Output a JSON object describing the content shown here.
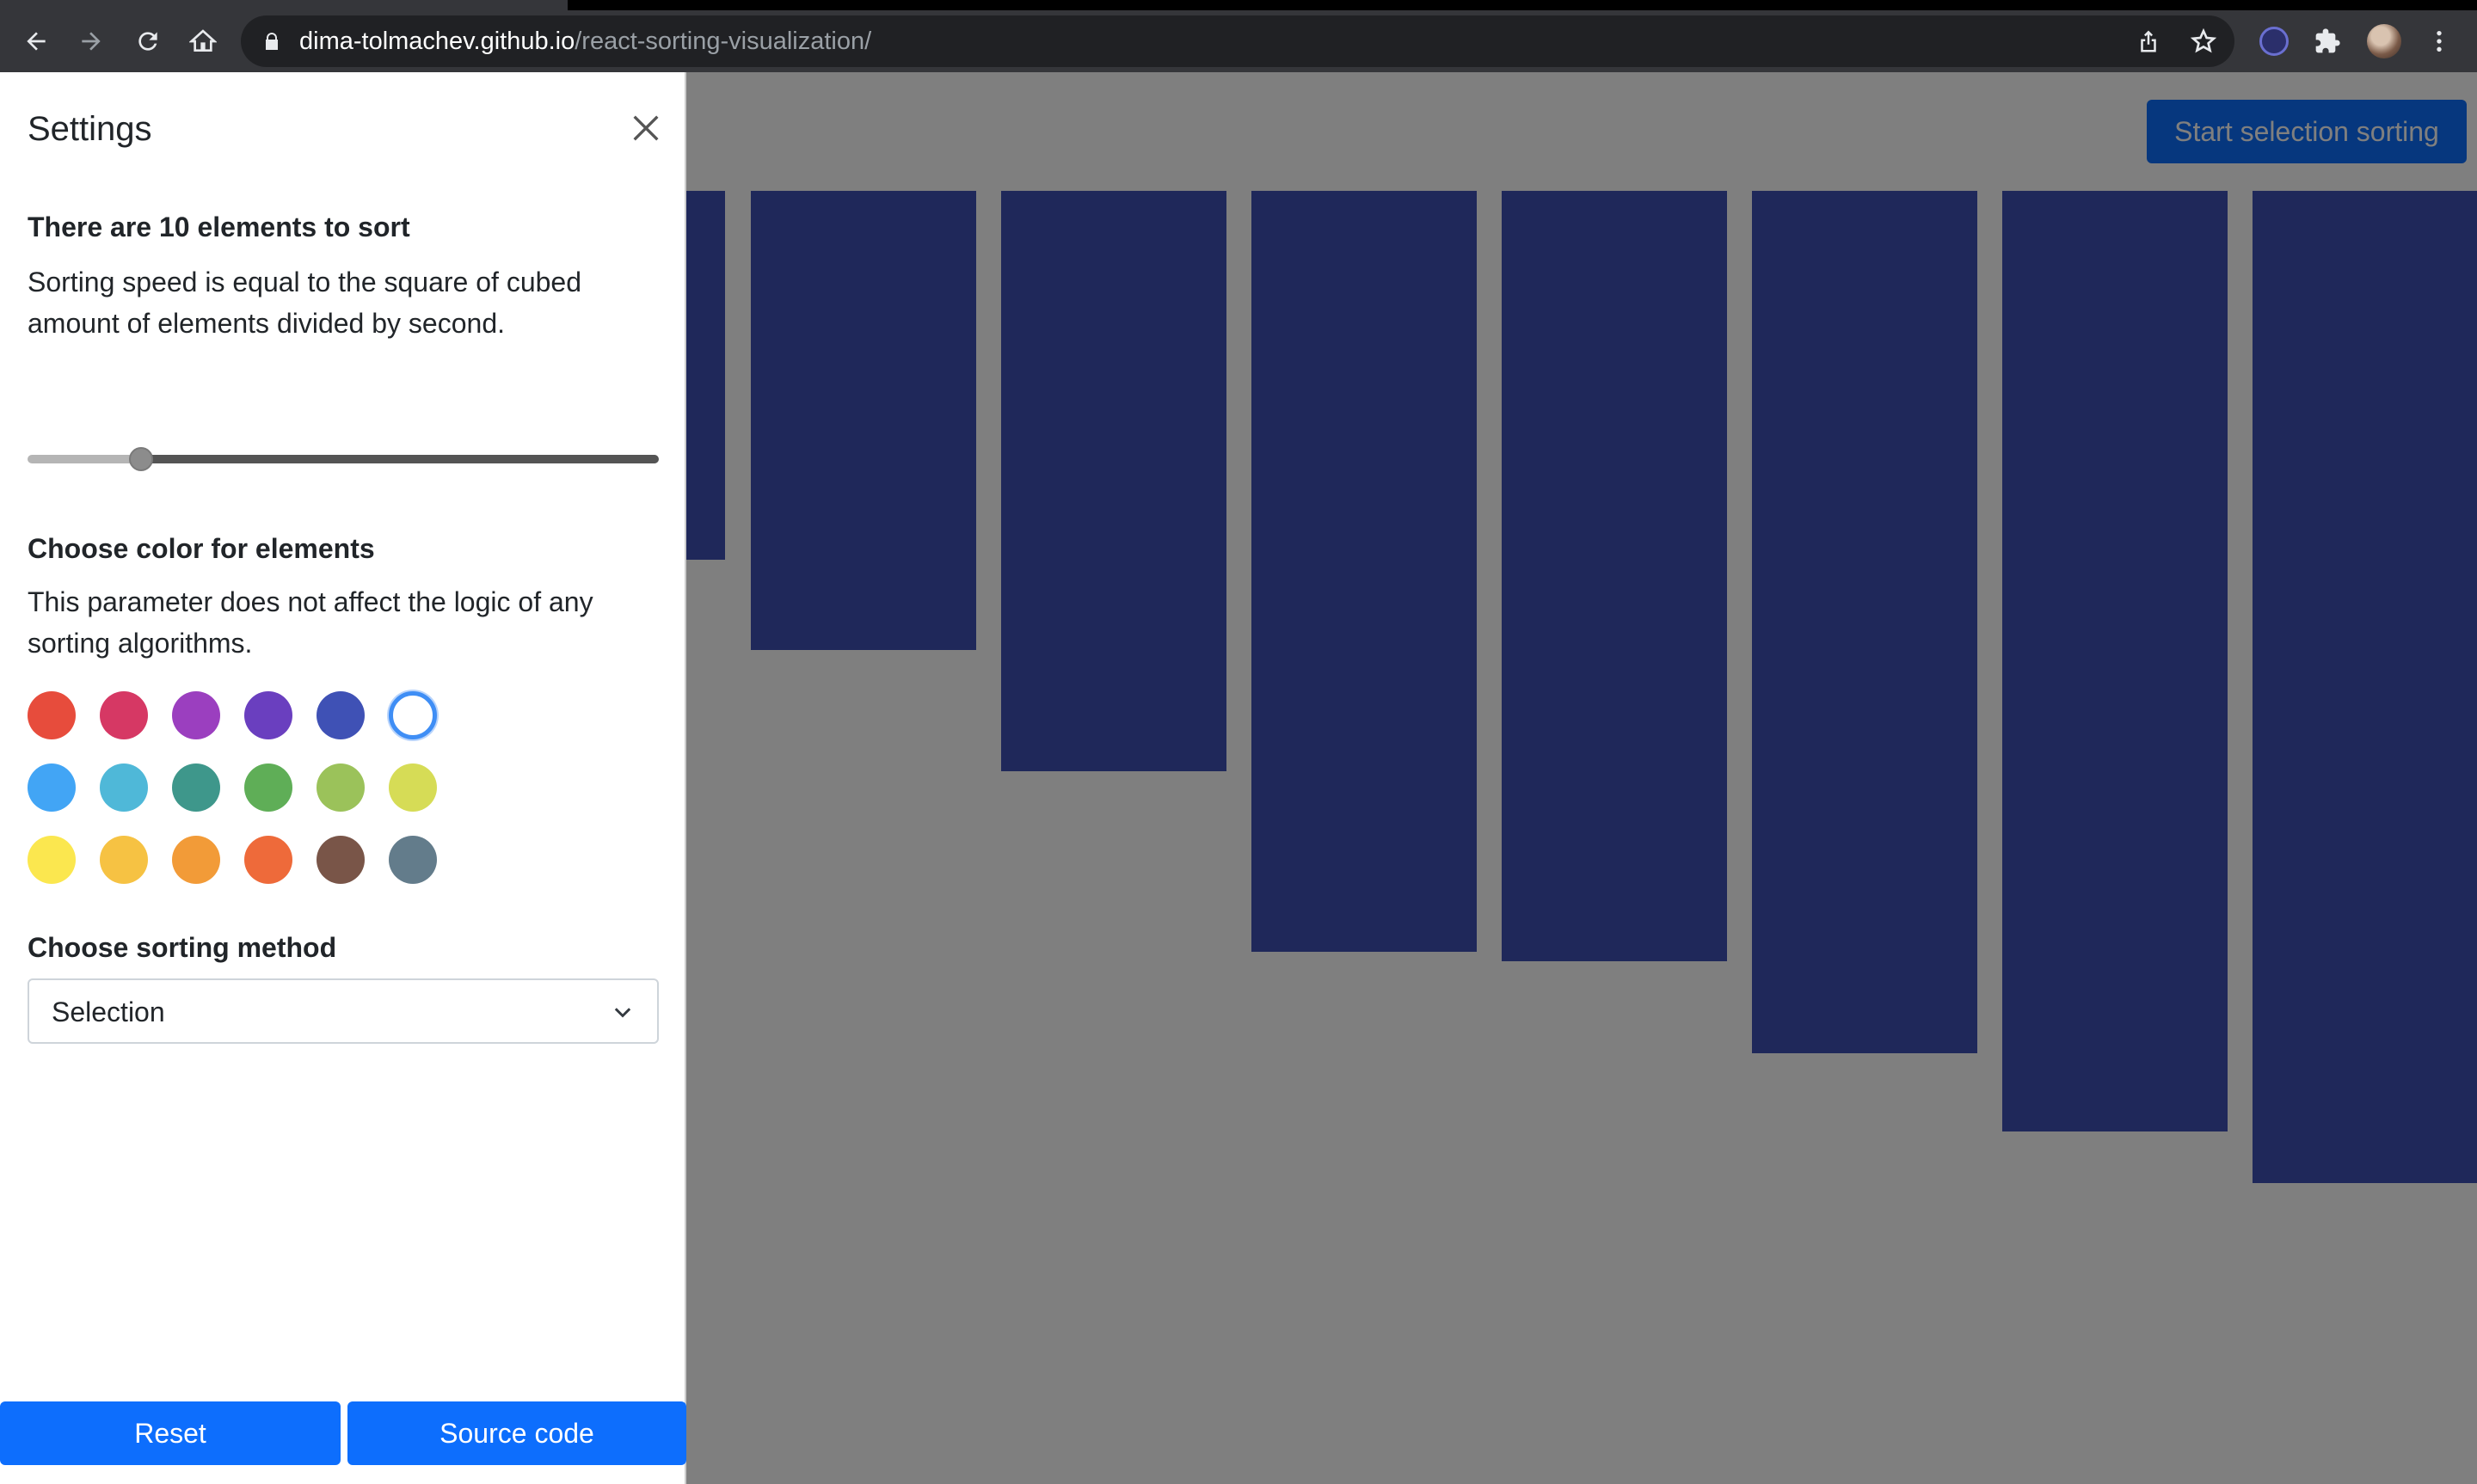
{
  "browser": {
    "url_host": "dima-tolmachev.github.io",
    "url_path": "/react-sorting-visualization/"
  },
  "main": {
    "start_button_label": "Start selection sorting",
    "bar_color": "#3f51b5",
    "bar_values": [
      268,
      334,
      422,
      553,
      560,
      627,
      684,
      721
    ]
  },
  "settings": {
    "title": "Settings",
    "elements_heading": "There are 10 elements to sort",
    "speed_description": "Sorting speed is equal to the square of cubed amount of elements divided by second.",
    "slider_level_fraction": 0.18,
    "color_heading": "Choose color for elements",
    "color_description": "This parameter does not affect the logic of any sorting algorithms.",
    "colors": [
      "#e74c3c",
      "#d63864",
      "#9b3fbf",
      "#6a3fbf",
      "#3f51b5",
      "#ffffff",
      "#42a5f5",
      "#4fb8d8",
      "#3e978b",
      "#5fae57",
      "#9bc25a",
      "#d6dc56",
      "#fbe74f",
      "#f6c243",
      "#f29b38",
      "#ee6a3a",
      "#795548",
      "#637c8b"
    ],
    "selected_color_index": 5,
    "method_heading": "Choose sorting method",
    "method_selected": "Selection",
    "reset_label": "Reset",
    "source_label": "Source code"
  }
}
